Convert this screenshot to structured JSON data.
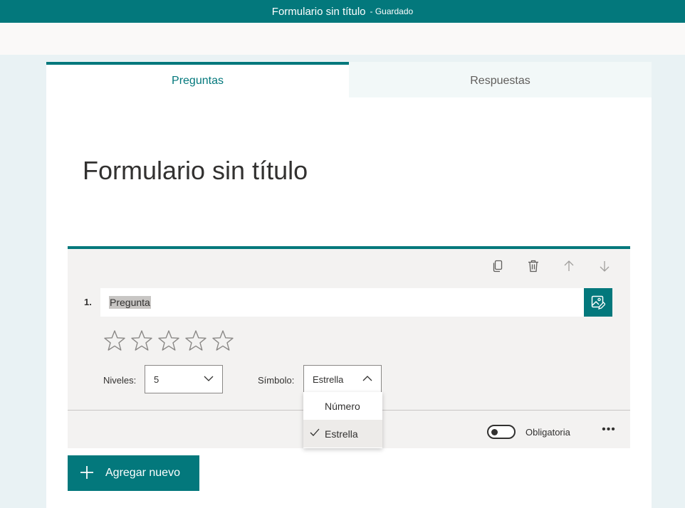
{
  "header": {
    "title": "Formulario sin título",
    "status": "- Guardado"
  },
  "tabs": [
    {
      "label": "Preguntas",
      "active": true
    },
    {
      "label": "Respuestas",
      "active": false
    }
  ],
  "form": {
    "title": "Formulario sin título"
  },
  "question": {
    "number": "1.",
    "text": "Pregunta",
    "actions": [
      "copy-icon",
      "delete-icon",
      "arrow-up-icon",
      "arrow-down-icon"
    ],
    "rating": {
      "levels_label": "Niveles:",
      "levels_value": "5",
      "symbol_label": "Símbolo:",
      "symbol_value": "Estrella",
      "stars": 5
    },
    "required_label": "Obligatoria",
    "required": false
  },
  "symbol_dropdown": {
    "options": [
      "Número",
      "Estrella"
    ],
    "selected": "Estrella"
  },
  "add_button": {
    "label": "Agregar nuevo"
  },
  "colors": {
    "accent": "#03787c"
  }
}
